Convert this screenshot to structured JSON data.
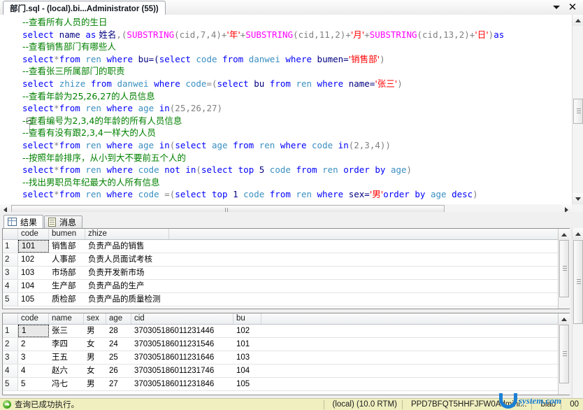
{
  "window": {
    "tab_title": "部门.sql - (local).bi...Administrator (55))",
    "dropdown_icon": "chevron-down-icon",
    "close_icon": "close-icon"
  },
  "editor": {
    "lines": [
      {
        "id": 1,
        "fold": "none",
        "segments": [
          {
            "t": "--查看所有人员的生日",
            "c": "cmt"
          }
        ]
      },
      {
        "id": 2,
        "fold": "none",
        "segments": [
          {
            "t": "select",
            "c": "kw"
          },
          {
            "t": " name ",
            "c": "pln"
          },
          {
            "t": "as",
            "c": "kw"
          },
          {
            "t": " 姓名",
            "c": "pln"
          },
          {
            "t": ",(",
            "c": "op"
          },
          {
            "t": "SUBSTRING",
            "c": "fn"
          },
          {
            "t": "(cid,7,4)+",
            "c": "op"
          },
          {
            "t": "'年'",
            "c": "str"
          },
          {
            "t": "+",
            "c": "op"
          },
          {
            "t": "SUBSTRING",
            "c": "fn"
          },
          {
            "t": "(cid,11,2)+",
            "c": "op"
          },
          {
            "t": "'月'",
            "c": "str"
          },
          {
            "t": "+",
            "c": "op"
          },
          {
            "t": "SUBSTRING",
            "c": "fn"
          },
          {
            "t": "(cid,13,2)+",
            "c": "op"
          },
          {
            "t": "'日'",
            "c": "str"
          },
          {
            "t": ")",
            "c": "op"
          },
          {
            "t": "as",
            "c": "kw"
          },
          {
            "t": " ",
            "c": "pln"
          }
        ]
      },
      {
        "id": 3,
        "fold": "none",
        "segments": [
          {
            "t": "--查看销售部门有哪些人",
            "c": "cmt"
          }
        ]
      },
      {
        "id": 4,
        "fold": "none",
        "segments": [
          {
            "t": "select",
            "c": "kw"
          },
          {
            "t": "*",
            "c": "op"
          },
          {
            "t": "from",
            "c": "kw"
          },
          {
            "t": " ",
            "c": "pln"
          },
          {
            "t": "ren",
            "c": "tbl"
          },
          {
            "t": " ",
            "c": "pln"
          },
          {
            "t": "where",
            "c": "kw"
          },
          {
            "t": " bu=(",
            "c": "pln"
          },
          {
            "t": "select",
            "c": "kw"
          },
          {
            "t": " ",
            "c": "pln"
          },
          {
            "t": "code",
            "c": "tbl"
          },
          {
            "t": " ",
            "c": "pln"
          },
          {
            "t": "from",
            "c": "kw"
          },
          {
            "t": " ",
            "c": "pln"
          },
          {
            "t": "danwei",
            "c": "tbl"
          },
          {
            "t": " ",
            "c": "pln"
          },
          {
            "t": "where",
            "c": "kw"
          },
          {
            "t": " bumen=",
            "c": "pln"
          },
          {
            "t": "'销售部'",
            "c": "str"
          },
          {
            "t": ")",
            "c": "op"
          }
        ]
      },
      {
        "id": 5,
        "fold": "none",
        "segments": [
          {
            "t": "--查看张三所属部门的职责",
            "c": "cmt"
          }
        ]
      },
      {
        "id": 6,
        "fold": "none",
        "segments": [
          {
            "t": "select",
            "c": "kw"
          },
          {
            "t": " ",
            "c": "pln"
          },
          {
            "t": "zhize",
            "c": "tbl"
          },
          {
            "t": " ",
            "c": "pln"
          },
          {
            "t": "from",
            "c": "kw"
          },
          {
            "t": " ",
            "c": "pln"
          },
          {
            "t": "danwei",
            "c": "tbl"
          },
          {
            "t": " ",
            "c": "pln"
          },
          {
            "t": "where",
            "c": "kw"
          },
          {
            "t": " ",
            "c": "pln"
          },
          {
            "t": "code",
            "c": "tbl"
          },
          {
            "t": "=(",
            "c": "op"
          },
          {
            "t": "select",
            "c": "kw"
          },
          {
            "t": " bu ",
            "c": "pln"
          },
          {
            "t": "from",
            "c": "kw"
          },
          {
            "t": " ",
            "c": "pln"
          },
          {
            "t": "ren",
            "c": "tbl"
          },
          {
            "t": " ",
            "c": "pln"
          },
          {
            "t": "where",
            "c": "kw"
          },
          {
            "t": " name=",
            "c": "pln"
          },
          {
            "t": "'张三'",
            "c": "str"
          },
          {
            "t": ")",
            "c": "op"
          }
        ]
      },
      {
        "id": 7,
        "fold": "none",
        "segments": [
          {
            "t": "--查看年龄为25,26,27的人员信息",
            "c": "cmt"
          }
        ]
      },
      {
        "id": 8,
        "fold": "none",
        "segments": [
          {
            "t": "select",
            "c": "kw"
          },
          {
            "t": "*",
            "c": "op"
          },
          {
            "t": "from",
            "c": "kw"
          },
          {
            "t": " ",
            "c": "pln"
          },
          {
            "t": "ren",
            "c": "tbl"
          },
          {
            "t": " ",
            "c": "pln"
          },
          {
            "t": "where",
            "c": "kw"
          },
          {
            "t": " ",
            "c": "pln"
          },
          {
            "t": "age",
            "c": "tbl"
          },
          {
            "t": " ",
            "c": "pln"
          },
          {
            "t": "in",
            "c": "kw"
          },
          {
            "t": "(25,26,27)",
            "c": "op"
          }
        ]
      },
      {
        "id": 9,
        "fold": "box",
        "segments": [
          {
            "t": "--查看编号为2,3,4的年龄的所有人员信息",
            "c": "cmt"
          }
        ]
      },
      {
        "id": 10,
        "fold": "tick",
        "segments": [
          {
            "t": "--查看有没有跟2,3,4一样大的人员",
            "c": "cmt"
          }
        ]
      },
      {
        "id": 11,
        "fold": "none",
        "segments": [
          {
            "t": "select",
            "c": "kw"
          },
          {
            "t": "*",
            "c": "op"
          },
          {
            "t": "from",
            "c": "kw"
          },
          {
            "t": " ",
            "c": "pln"
          },
          {
            "t": "ren",
            "c": "tbl"
          },
          {
            "t": " ",
            "c": "pln"
          },
          {
            "t": "where",
            "c": "kw"
          },
          {
            "t": " ",
            "c": "pln"
          },
          {
            "t": "age",
            "c": "tbl"
          },
          {
            "t": " ",
            "c": "pln"
          },
          {
            "t": "in",
            "c": "kw"
          },
          {
            "t": "(",
            "c": "op"
          },
          {
            "t": "select",
            "c": "kw"
          },
          {
            "t": " ",
            "c": "pln"
          },
          {
            "t": "age",
            "c": "tbl"
          },
          {
            "t": " ",
            "c": "pln"
          },
          {
            "t": "from",
            "c": "kw"
          },
          {
            "t": " ",
            "c": "pln"
          },
          {
            "t": "ren",
            "c": "tbl"
          },
          {
            "t": " ",
            "c": "pln"
          },
          {
            "t": "where",
            "c": "kw"
          },
          {
            "t": " ",
            "c": "pln"
          },
          {
            "t": "code",
            "c": "tbl"
          },
          {
            "t": " ",
            "c": "pln"
          },
          {
            "t": "in",
            "c": "kw"
          },
          {
            "t": "(2,3,4))",
            "c": "op"
          }
        ]
      },
      {
        "id": 12,
        "fold": "none",
        "segments": [
          {
            "t": "--按照年龄排序，从小到大不要前五个人的",
            "c": "cmt"
          }
        ]
      },
      {
        "id": 13,
        "fold": "none",
        "segments": [
          {
            "t": "select",
            "c": "kw"
          },
          {
            "t": "*",
            "c": "op"
          },
          {
            "t": "from",
            "c": "kw"
          },
          {
            "t": " ",
            "c": "pln"
          },
          {
            "t": "ren",
            "c": "tbl"
          },
          {
            "t": " ",
            "c": "pln"
          },
          {
            "t": "where",
            "c": "kw"
          },
          {
            "t": " ",
            "c": "pln"
          },
          {
            "t": "code",
            "c": "tbl"
          },
          {
            "t": " ",
            "c": "pln"
          },
          {
            "t": "not",
            "c": "kw"
          },
          {
            "t": " ",
            "c": "pln"
          },
          {
            "t": "in",
            "c": "kw"
          },
          {
            "t": "(",
            "c": "op"
          },
          {
            "t": "select",
            "c": "kw"
          },
          {
            "t": " ",
            "c": "pln"
          },
          {
            "t": "top",
            "c": "kw"
          },
          {
            "t": " 5 ",
            "c": "pln"
          },
          {
            "t": "code",
            "c": "tbl"
          },
          {
            "t": " ",
            "c": "pln"
          },
          {
            "t": "from",
            "c": "kw"
          },
          {
            "t": " ",
            "c": "pln"
          },
          {
            "t": "ren",
            "c": "tbl"
          },
          {
            "t": " ",
            "c": "pln"
          },
          {
            "t": "order",
            "c": "kw"
          },
          {
            "t": " ",
            "c": "pln"
          },
          {
            "t": "by",
            "c": "kw"
          },
          {
            "t": " ",
            "c": "pln"
          },
          {
            "t": "age",
            "c": "tbl"
          },
          {
            "t": ")",
            "c": "op"
          }
        ]
      },
      {
        "id": 14,
        "fold": "none",
        "segments": [
          {
            "t": "--找出男职员年纪最大的人所有信息",
            "c": "cmt"
          }
        ]
      },
      {
        "id": 15,
        "fold": "none",
        "segments": [
          {
            "t": "select",
            "c": "kw"
          },
          {
            "t": "*",
            "c": "op"
          },
          {
            "t": "from",
            "c": "kw"
          },
          {
            "t": " ",
            "c": "pln"
          },
          {
            "t": "ren",
            "c": "tbl"
          },
          {
            "t": " ",
            "c": "pln"
          },
          {
            "t": "where",
            "c": "kw"
          },
          {
            "t": " ",
            "c": "pln"
          },
          {
            "t": "code",
            "c": "tbl"
          },
          {
            "t": " =(",
            "c": "op"
          },
          {
            "t": "select",
            "c": "kw"
          },
          {
            "t": " ",
            "c": "pln"
          },
          {
            "t": "top",
            "c": "kw"
          },
          {
            "t": " 1 ",
            "c": "pln"
          },
          {
            "t": "code",
            "c": "tbl"
          },
          {
            "t": " ",
            "c": "pln"
          },
          {
            "t": "from",
            "c": "kw"
          },
          {
            "t": " ",
            "c": "pln"
          },
          {
            "t": "ren",
            "c": "tbl"
          },
          {
            "t": " ",
            "c": "pln"
          },
          {
            "t": "where",
            "c": "kw"
          },
          {
            "t": " sex=",
            "c": "pln"
          },
          {
            "t": "'男'",
            "c": "str"
          },
          {
            "t": "order",
            "c": "kw"
          },
          {
            "t": " ",
            "c": "pln"
          },
          {
            "t": "by",
            "c": "kw"
          },
          {
            "t": " ",
            "c": "pln"
          },
          {
            "t": "age",
            "c": "tbl"
          },
          {
            "t": " ",
            "c": "pln"
          },
          {
            "t": "desc",
            "c": "kw"
          },
          {
            "t": ")",
            "c": "op"
          }
        ]
      }
    ]
  },
  "results": {
    "tabs": [
      {
        "label": "结果",
        "icon": "grid-icon",
        "active": true
      },
      {
        "label": "消息",
        "icon": "message-icon",
        "active": false
      }
    ],
    "grid1": {
      "columns": [
        "code",
        "bumen",
        "zhize"
      ],
      "rows": [
        {
          "n": "1",
          "cells": [
            "101",
            "销售部",
            "负责产品的销售"
          ]
        },
        {
          "n": "2",
          "cells": [
            "102",
            "人事部",
            "负责人员面试考核"
          ]
        },
        {
          "n": "3",
          "cells": [
            "103",
            "市场部",
            "负责开发新市场"
          ]
        },
        {
          "n": "4",
          "cells": [
            "104",
            "生产部",
            "负责产品的生产"
          ]
        },
        {
          "n": "5",
          "cells": [
            "105",
            "质检部",
            "负责产品的质量检测"
          ]
        }
      ]
    },
    "grid2": {
      "columns": [
        "code",
        "name",
        "sex",
        "age",
        "cid",
        "bu"
      ],
      "rows": [
        {
          "n": "1",
          "cells": [
            "1",
            "张三",
            "男",
            "28",
            "370305186011231446",
            "102"
          ]
        },
        {
          "n": "2",
          "cells": [
            "2",
            "李四",
            "女",
            "24",
            "370305186011231546",
            "101"
          ]
        },
        {
          "n": "3",
          "cells": [
            "3",
            "王五",
            "男",
            "25",
            "370305186011231646",
            "103"
          ]
        },
        {
          "n": "4",
          "cells": [
            "4",
            "赵六",
            "女",
            "26",
            "370305186011231746",
            "104"
          ]
        },
        {
          "n": "5",
          "cells": [
            "5",
            "冯七",
            "男",
            "27",
            "370305186011231846",
            "105"
          ]
        }
      ]
    }
  },
  "statusbar": {
    "status_icon": "success-icon",
    "status_text": "查询已成功执行。",
    "server": "(local) (10.0 RTM)",
    "user": "PPD7BFQT5HHFJFW0Admini...",
    "database": "biao",
    "rows": "00"
  },
  "watermark": {
    "logo": "u-logo-icon",
    "text": "system.com"
  },
  "colors": {
    "comment": "#008000",
    "keyword": "#0000ff",
    "string": "#ff0000",
    "function": "#ff00ff",
    "table": "#3a8fc0",
    "statusbar_bg": "#f0efc0",
    "watermark": "#1b7fd4"
  }
}
